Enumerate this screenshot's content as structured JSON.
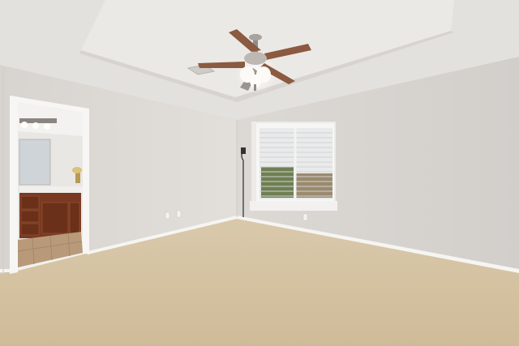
{
  "scene": {
    "subject": "empty-bedroom",
    "colors": {
      "ceiling": "#e4e2df",
      "ceiling_tray": "#ebe9e6",
      "wall_left": "#dedbd7",
      "wall_right": "#d8d5d1",
      "carpet": "#d6c4a5",
      "trim": "#f4f3f1",
      "cabinet": "#7a3a22",
      "window_glass": "#eef0f2"
    },
    "icons": [
      "ceiling-fan-icon",
      "window-icon",
      "doorway-icon",
      "outlet-icon"
    ]
  }
}
